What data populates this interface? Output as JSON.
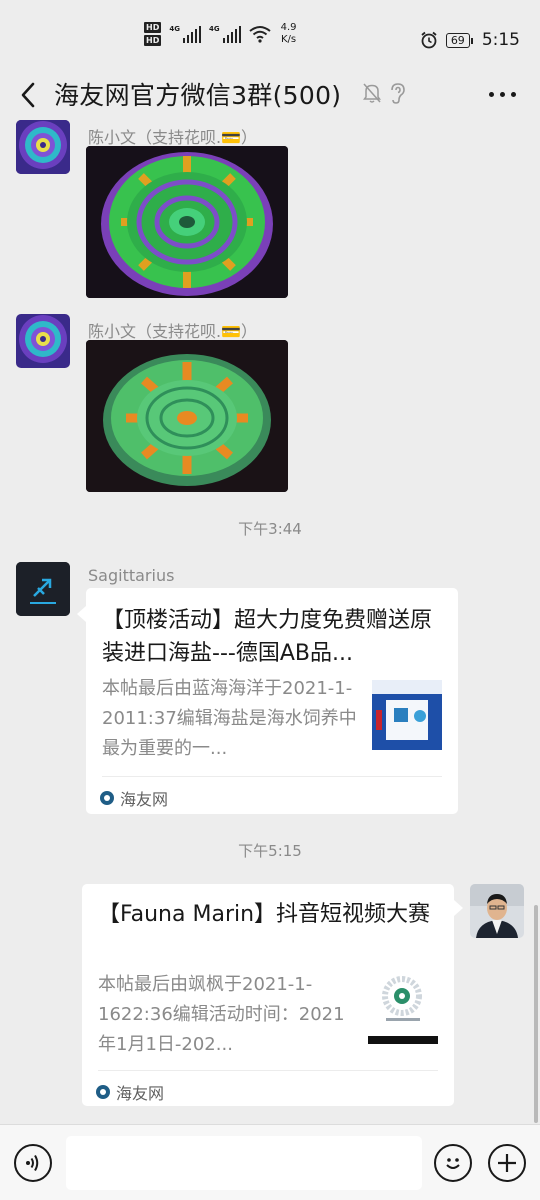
{
  "status_bar": {
    "hd1": "HD",
    "hd2": "HD",
    "net1": "4G",
    "net2": "4G",
    "speed_value": "4.9",
    "speed_unit": "K/s",
    "battery": "69",
    "time": "5:15"
  },
  "header": {
    "title": "海友网官方微信3群(500)"
  },
  "messages": [
    {
      "sender": "陈小文（支持花呗.💳）"
    },
    {
      "sender": "陈小文（支持花呗.💳）"
    }
  ],
  "timestamps": [
    "下午3:44",
    "下午5:15"
  ],
  "shared_links": [
    {
      "sender": "Sagittarius",
      "title": "【顶楼活动】超大力度免费赠送原装进口海盐---德国AB品...",
      "desc": "本帖最后由蓝海海洋于2021-1-2011:37编辑海盐是海水饲养中最为重要的一...",
      "source": "海友网"
    },
    {
      "title": "【Fauna Marin】抖音短视频大赛",
      "desc": "本帖最后由飒枫于2021-1-1622:36编辑活动时间：2021年1月1日-202...",
      "source": "海友网"
    }
  ],
  "input": {
    "placeholder": ""
  }
}
